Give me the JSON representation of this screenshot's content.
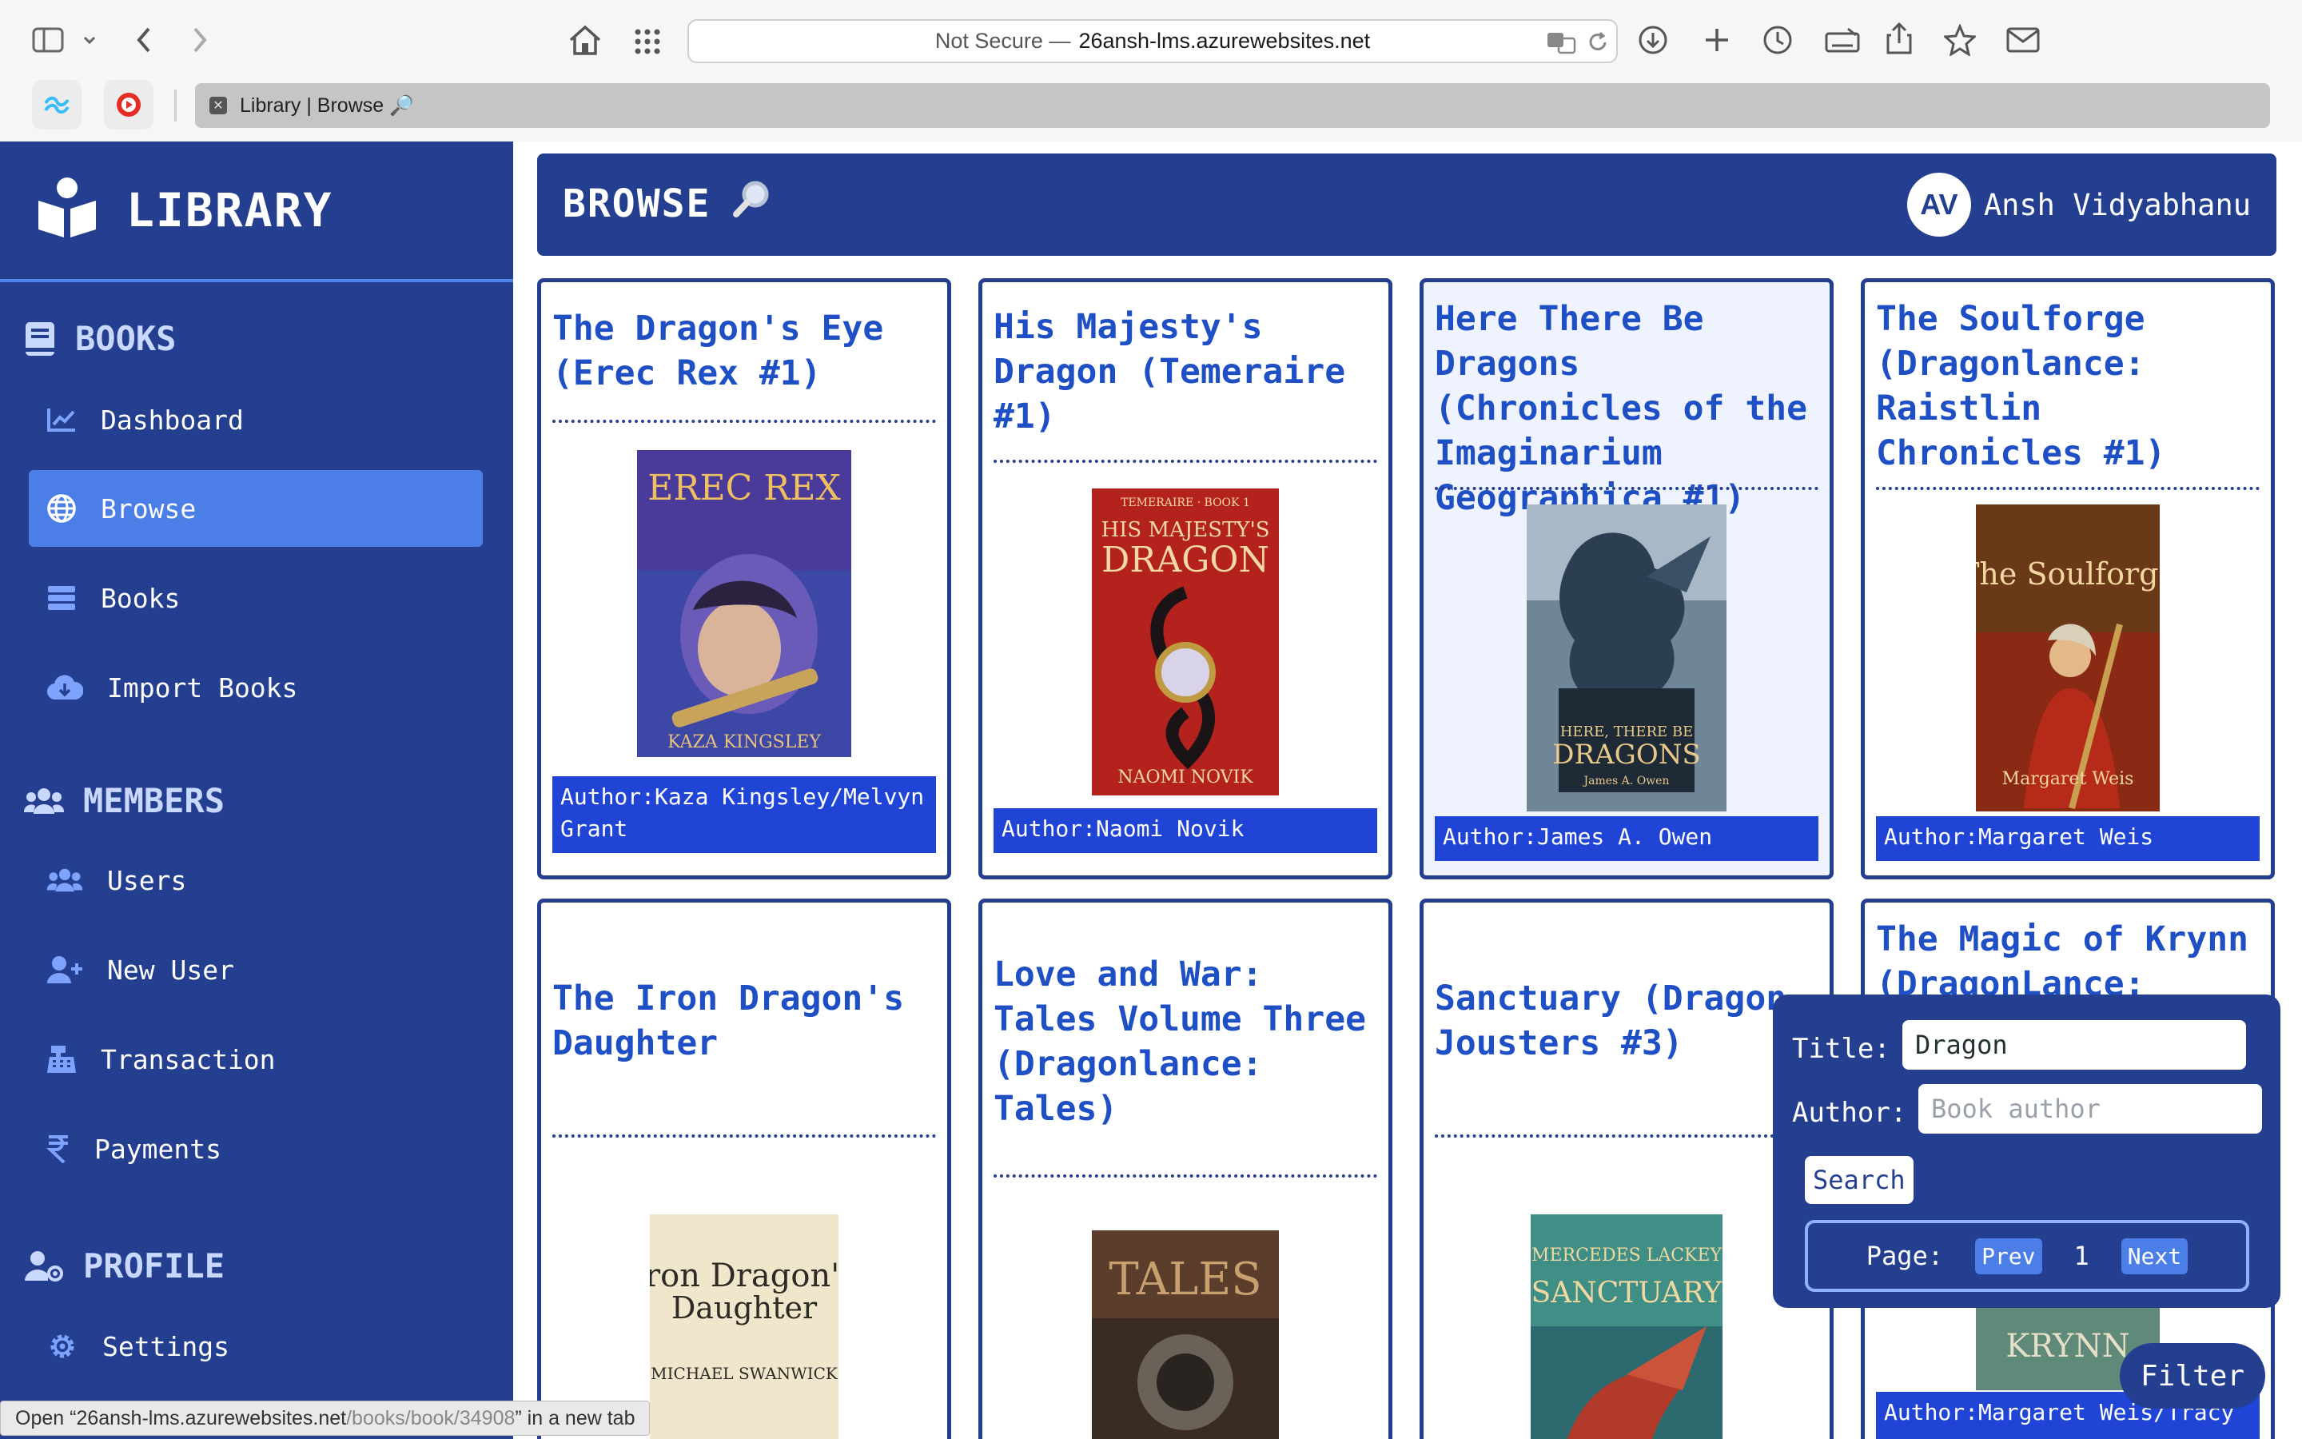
{
  "browser": {
    "url_prefix": "Not Secure —",
    "url_host": "26ansh-lms.azurewebsites.net",
    "tab_title": "Library | Browse 🔎"
  },
  "sidebar": {
    "brand": "LIBRARY",
    "sections": [
      {
        "label": "BOOKS",
        "icon": "book-icon"
      },
      {
        "label": "MEMBERS",
        "icon": "users-icon"
      },
      {
        "label": "PROFILE",
        "icon": "user-cog-icon"
      }
    ],
    "items": [
      {
        "label": "Dashboard",
        "icon": "chart-line-icon"
      },
      {
        "label": "Browse",
        "icon": "globe-icon",
        "active": true
      },
      {
        "label": "Books",
        "icon": "database-icon"
      },
      {
        "label": "Import Books",
        "icon": "cloud-download-icon"
      },
      {
        "label": "Users",
        "icon": "users-icon"
      },
      {
        "label": "New User",
        "icon": "user-plus-icon"
      },
      {
        "label": "Transaction",
        "icon": "cash-register-icon"
      },
      {
        "label": "Payments",
        "icon": "rupee-icon"
      },
      {
        "label": "Settings",
        "icon": "gear-icon"
      }
    ]
  },
  "header": {
    "title": "BROWSE",
    "title_icon": "magnifier-emoji",
    "avatar_initials": "AV",
    "user_name": "Ansh Vidyabhanu"
  },
  "books": [
    {
      "title": "The Dragon's Eye (Erec Rex #1)",
      "author": "Author:Kaza Kingsley/Melvyn Grant",
      "cover_title": "EREC REX",
      "cover_author": "KAZA KINGSLEY"
    },
    {
      "title": "His Majesty's Dragon (Temeraire #1)",
      "author": "Author:Naomi Novik",
      "cover_title": "HIS MAJESTY'S DRAGON",
      "cover_author": "NAOMI NOVIK"
    },
    {
      "title": "Here There Be Dragons (Chronicles of the Imaginarium Geographica #1)",
      "author": "Author:James A. Owen",
      "cover_title": "HERE, THERE BE DRAGONS",
      "cover_author": "James A. Owen"
    },
    {
      "title": "The Soulforge (Dragonlance: Raistlin Chronicles #1)",
      "author": "Author:Margaret Weis",
      "cover_title": "The Soulforge",
      "cover_author": "Margaret Weis"
    },
    {
      "title": "The Iron Dragon's Daughter",
      "author": "",
      "cover_title": "The Iron Dragon's Daughter",
      "cover_author": "MICHAEL SWANWICK"
    },
    {
      "title": "Love and War: Tales Volume Three (Dragonlance: Tales)",
      "author": "",
      "cover_title": "TALES",
      "cover_author": ""
    },
    {
      "title": "Sanctuary (Dragon Jousters #3)",
      "author": "",
      "cover_title": "SANCTUARY",
      "cover_author": "MERCEDES LACKEY"
    },
    {
      "title": "The Magic of Krynn (DragonLance: Tales",
      "author": "Author:Margaret Weis/Tracy",
      "cover_title": "KRYNN",
      "cover_author": ""
    }
  ],
  "filter": {
    "title_label": "Title:",
    "title_value": "Dragon",
    "author_label": "Author:",
    "author_placeholder": "Book author",
    "search_label": "Search",
    "page_label": "Page:",
    "prev_label": "Prev",
    "page_number": "1",
    "next_label": "Next",
    "toggle_label": "Filter"
  },
  "status_bar": {
    "prefix": "Open “",
    "host": "26ansh-lms.azurewebsites.net",
    "path": "/books/book/34908",
    "suffix": "” in a new tab"
  },
  "colors": {
    "primary": "#243f8f",
    "accent": "#4c7ee8",
    "title_blue": "#1f4fc4",
    "author_bg": "#1f44d6"
  }
}
